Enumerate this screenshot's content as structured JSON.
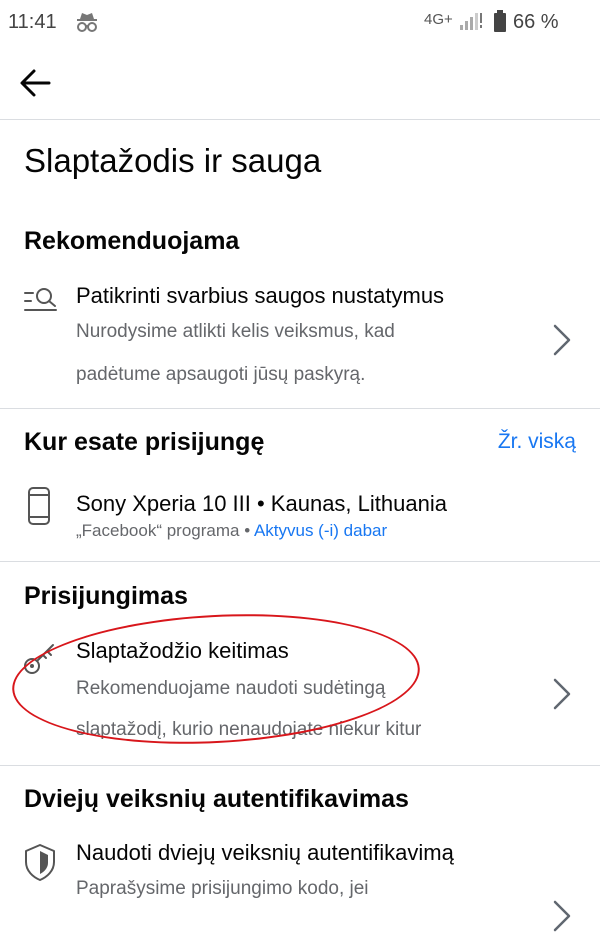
{
  "status_bar": {
    "time": "11:41",
    "network": "4G+",
    "battery": "66 %",
    "icons": [
      "incognito-icon",
      "signal-icon",
      "battery-icon"
    ]
  },
  "header": {
    "back_icon": "back-arrow-icon"
  },
  "page": {
    "title": "Slaptažodis ir sauga"
  },
  "sections": {
    "recommended": {
      "title": "Rekomenduojama",
      "item": {
        "icon": "search-list-icon",
        "title": "Patikrinti svarbius saugos nustatymus",
        "desc_line1": "Nurodysime atlikti kelis veiksmus, kad",
        "desc_line2": "padėtume apsaugoti jūsų paskyrą."
      }
    },
    "logged_in": {
      "title": "Kur esate prisijungę",
      "see_all": "Žr. viską",
      "device": {
        "icon": "phone-icon",
        "name": "Sony Xperia 10 III • Kaunas, Lithuania",
        "app": "„Facebook“ programa",
        "separator": " • ",
        "status": "Aktyvus (-i) dabar"
      }
    },
    "login": {
      "title": "Prisijungimas",
      "item": {
        "icon": "key-icon",
        "title": "Slaptažodžio keitimas",
        "desc_line1": "Rekomenduojame naudoti sudėtingą",
        "desc_line2": "slaptažodį, kurio nenaudojate niekur kitur"
      }
    },
    "two_factor": {
      "title": "Dviejų veiksnių autentifikavimas",
      "item": {
        "icon": "shield-icon",
        "title": "Naudoti dviejų veiksnių autentifikavimą",
        "desc_line1": "Paprašysime prisijungimo kodo, jei"
      }
    }
  },
  "colors": {
    "accent": "#1877f2",
    "annotation": "#d8161b",
    "secondary_text": "#65676b"
  }
}
